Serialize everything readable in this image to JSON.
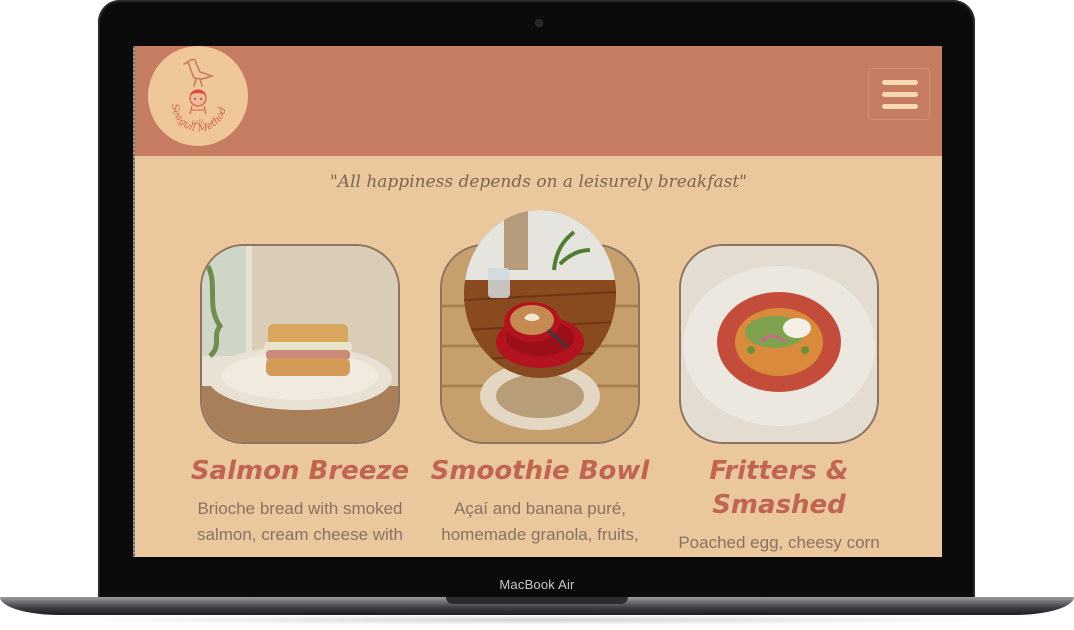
{
  "device": {
    "label": "MacBook Air"
  },
  "header": {
    "logo_top_text": "café",
    "logo_name": "Seagull Method",
    "menu_icon": "hamburger-menu-icon"
  },
  "tagline": "\"All happiness depends on a leisurely breakfast\"",
  "menu_items": [
    {
      "title": "Salmon Breeze",
      "description": "Brioche bread with smoked salmon, cream cheese with"
    },
    {
      "title": "Smoothie Bowl",
      "description": "Açaí and banana puré, homemade granola, fruits,"
    },
    {
      "title": "Fritters & Smashed",
      "description": "Poached egg, cheesy corn"
    }
  ],
  "colors": {
    "header": "#c67c60",
    "background": "#ebc79e",
    "accent": "#c0654f",
    "text": "#8a7262"
  }
}
